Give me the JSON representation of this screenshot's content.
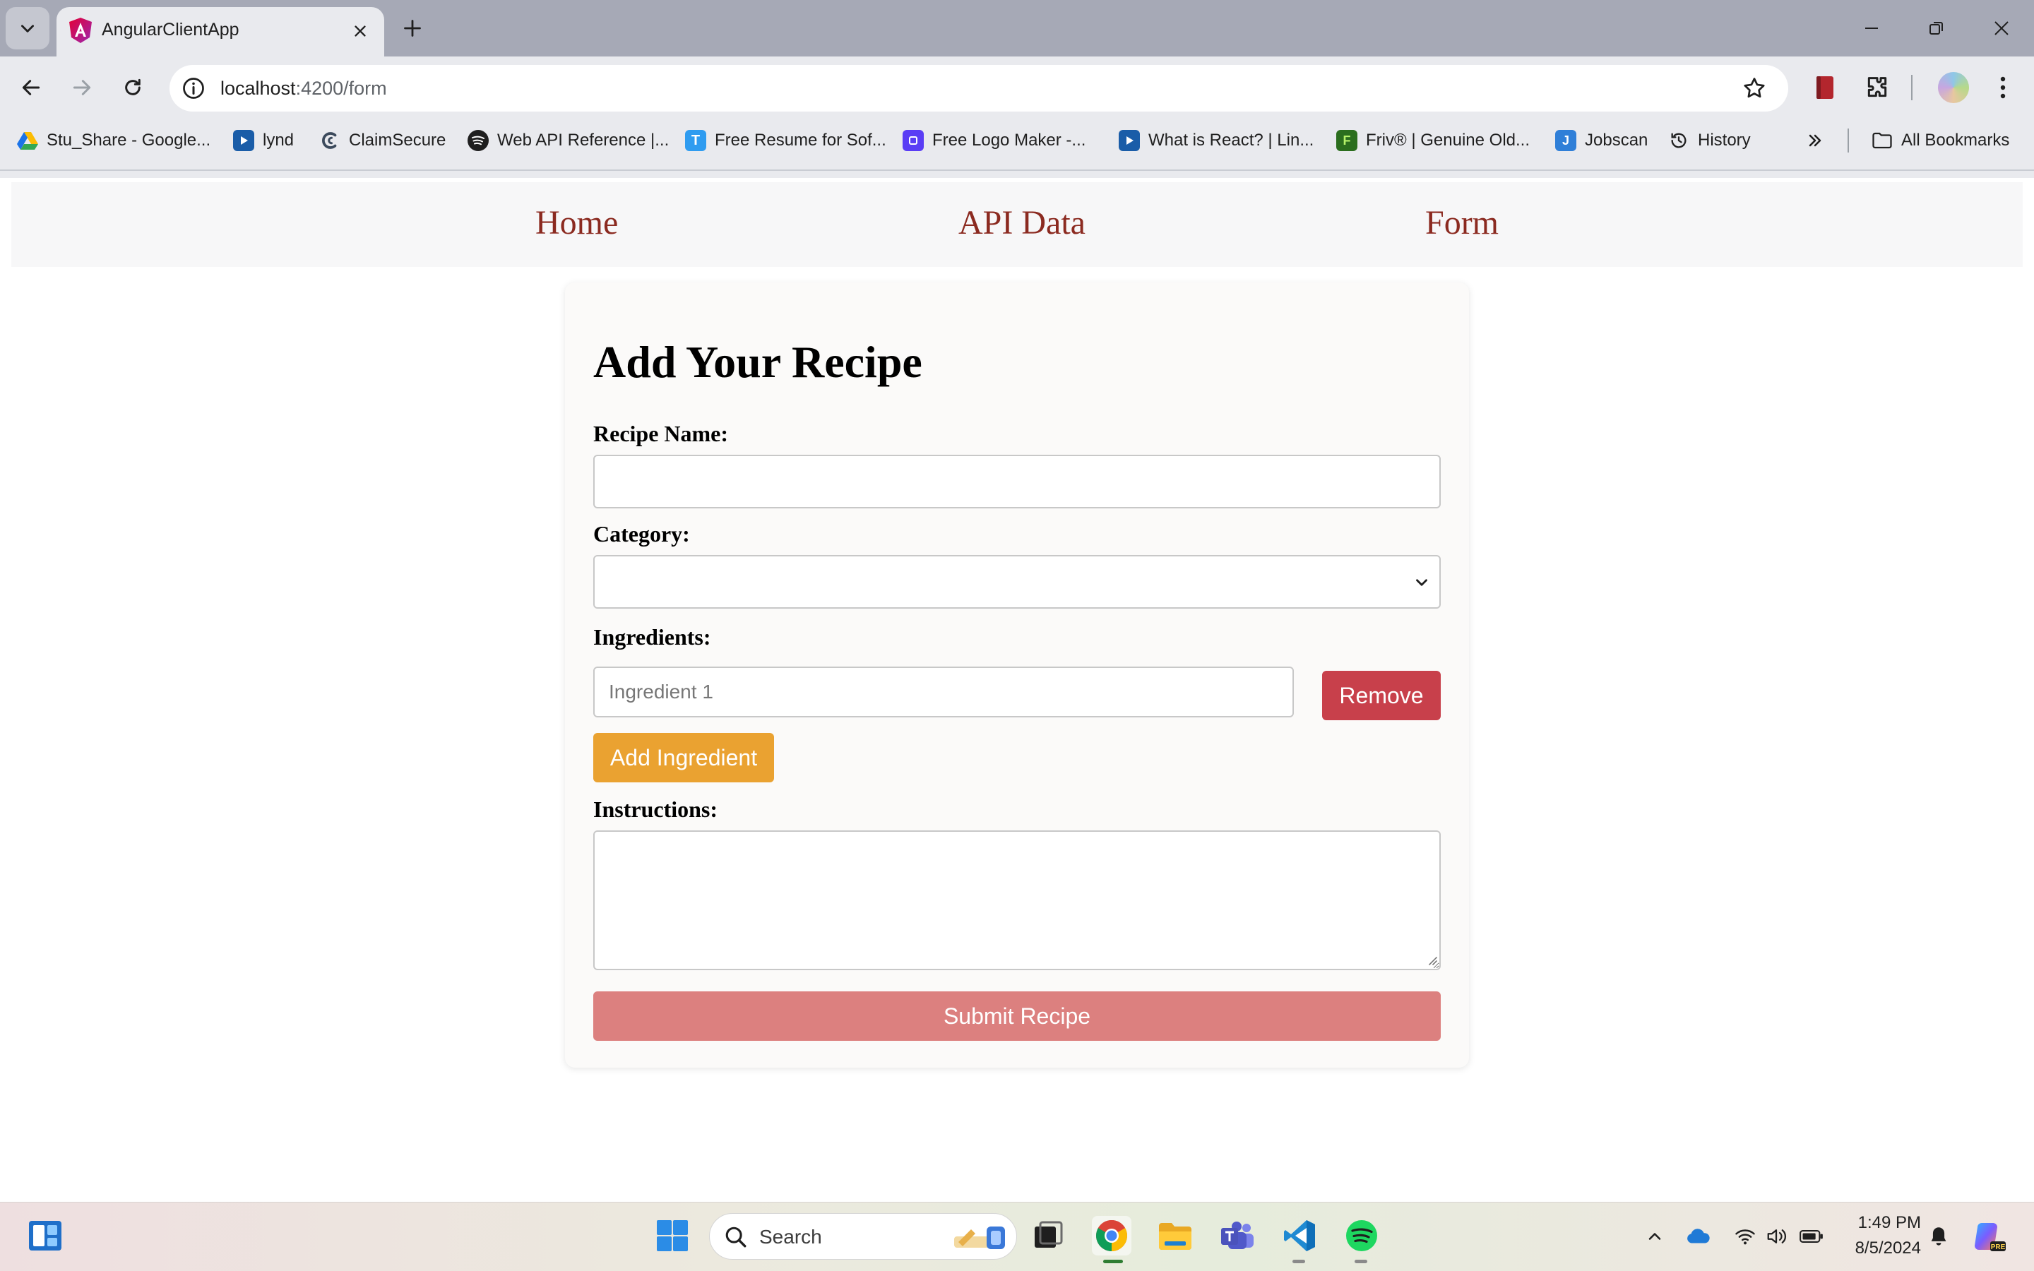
{
  "browser": {
    "tab_title": "AngularClientApp",
    "url_host": "localhost",
    "url_rest": ":4200/form",
    "bookmarks": [
      {
        "label": "Stu_Share - Google...",
        "icon": "google-drive-icon"
      },
      {
        "label": "lynd",
        "icon": "video-icon"
      },
      {
        "label": "ClaimSecure",
        "icon": "claimsecure-icon"
      },
      {
        "label": "Web API Reference |...",
        "icon": "spotify-icon"
      },
      {
        "label": "Free Resume for Sof...",
        "icon": "resume-icon"
      },
      {
        "label": "Free Logo Maker -...",
        "icon": "logo-maker-icon"
      },
      {
        "label": "What is React? | Lin...",
        "icon": "video-icon"
      },
      {
        "label": "Friv® | Genuine Old...",
        "icon": "friv-icon"
      },
      {
        "label": "Jobscan",
        "icon": "jobscan-icon"
      },
      {
        "label": "History",
        "icon": "history-icon"
      }
    ],
    "all_bookmarks": "All Bookmarks"
  },
  "nav": {
    "home": "Home",
    "api_data": "API Data",
    "form": "Form"
  },
  "form": {
    "title": "Add Your Recipe",
    "recipe_name_label": "Recipe Name:",
    "recipe_name_value": "",
    "category_label": "Category:",
    "category_value": "",
    "ingredients_label": "Ingredients:",
    "ingredient_placeholder": "Ingredient 1",
    "remove_label": "Remove",
    "add_ingredient_label": "Add Ingredient",
    "instructions_label": "Instructions:",
    "instructions_value": "",
    "submit_label": "Submit Recipe"
  },
  "taskbar": {
    "search_placeholder": "Search",
    "time": "1:49 PM",
    "date": "8/5/2024"
  },
  "colors": {
    "nav_link": "#8b2a20",
    "remove_button": "#c8404b",
    "add_button": "#eaa231",
    "submit_button": "#dc807f"
  }
}
